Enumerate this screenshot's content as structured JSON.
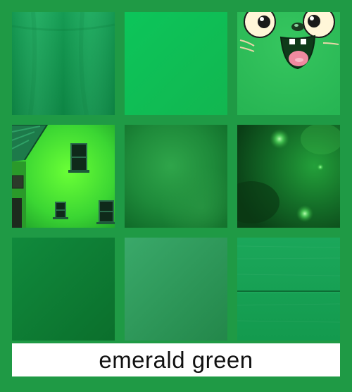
{
  "caption": "emerald green",
  "colors": {
    "background": "#1f9a45",
    "caption_background": "#ffffff",
    "caption_text": "#111111"
  },
  "swatches": [
    {
      "id": "fabric-drape",
      "color": "#129a50"
    },
    {
      "id": "flat-bright",
      "color": "#0fbf55"
    },
    {
      "id": "cartoon-cat",
      "color": "#2fbf5a"
    },
    {
      "id": "painted-house",
      "color": "#36d83a"
    },
    {
      "id": "blurred-glow",
      "color": "#1e8a3a"
    },
    {
      "id": "nebula",
      "color": "#0f5a22"
    },
    {
      "id": "dark-gradient",
      "color": "#0e7a33"
    },
    {
      "id": "muted-gradient",
      "color": "#2f9a5c"
    },
    {
      "id": "wood-panel",
      "color": "#17a055"
    }
  ]
}
